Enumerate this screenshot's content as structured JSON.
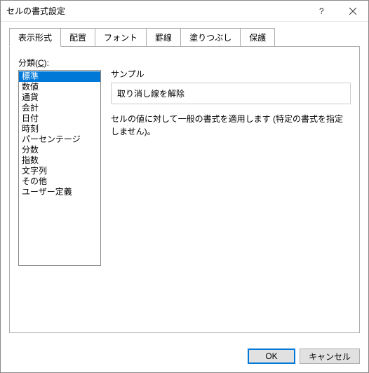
{
  "title": "セルの書式設定",
  "tabs": [
    {
      "label": "表示形式",
      "active": true
    },
    {
      "label": "配置",
      "active": false
    },
    {
      "label": "フォント",
      "active": false
    },
    {
      "label": "罫線",
      "active": false
    },
    {
      "label": "塗りつぶし",
      "active": false
    },
    {
      "label": "保護",
      "active": false
    }
  ],
  "category": {
    "label_prefix": "分類(",
    "label_key": "C",
    "label_suffix": "):",
    "items": [
      "標準",
      "数値",
      "通貨",
      "会計",
      "日付",
      "時刻",
      "パーセンテージ",
      "分数",
      "指数",
      "文字列",
      "その他",
      "ユーザー定義"
    ],
    "selected_index": 0
  },
  "sample": {
    "label": "サンプル",
    "value": "取り消し線を解除"
  },
  "description": "セルの値に対して一般の書式を適用します (特定の書式を指定しません)。",
  "buttons": {
    "ok": "OK",
    "cancel": "キャンセル"
  }
}
